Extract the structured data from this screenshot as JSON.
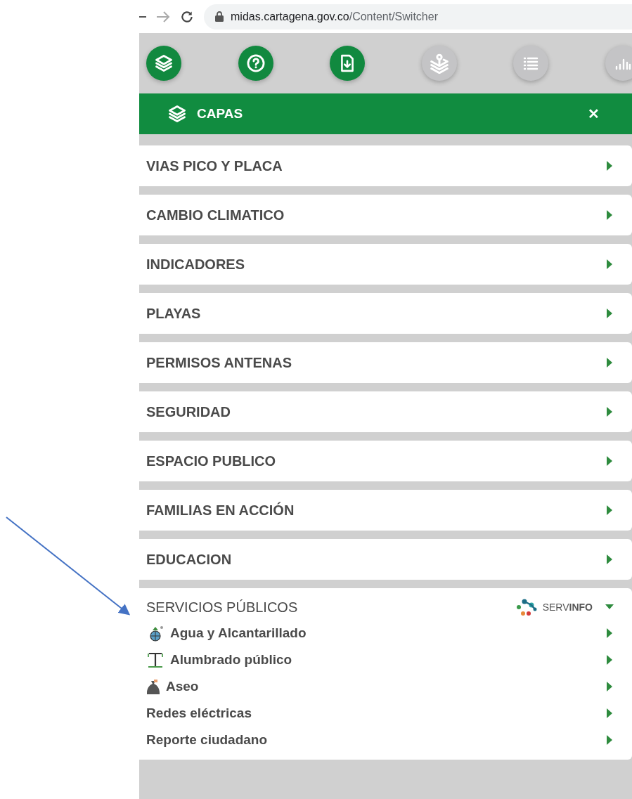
{
  "browser": {
    "url_host": "midas.cartagena.gov.co",
    "url_path": "/Content/Switcher"
  },
  "toolbar": [
    {
      "kind": "layers",
      "disabled": false
    },
    {
      "kind": "help",
      "disabled": false
    },
    {
      "kind": "download",
      "disabled": false
    },
    {
      "kind": "pin-layers",
      "disabled": true
    },
    {
      "kind": "list",
      "disabled": true
    },
    {
      "kind": "chart",
      "disabled": true
    }
  ],
  "panel": {
    "title": "CAPAS",
    "close": "✕"
  },
  "groups": [
    {
      "label": "VIAS PICO Y PLACA",
      "expanded": false
    },
    {
      "label": "CAMBIO CLIMATICO",
      "expanded": false
    },
    {
      "label": "INDICADORES",
      "expanded": false
    },
    {
      "label": "PLAYAS",
      "expanded": false
    },
    {
      "label": "PERMISOS ANTENAS",
      "expanded": false
    },
    {
      "label": "SEGURIDAD",
      "expanded": false
    },
    {
      "label": "ESPACIO PUBLICO",
      "expanded": false
    },
    {
      "label": "FAMILIAS EN ACCIÓN",
      "expanded": false
    },
    {
      "label": "EDUCACION",
      "expanded": false
    },
    {
      "label": "SERVICIOS PÚBLICOS",
      "expanded": true,
      "brand": "SERV**INFO**",
      "children": [
        {
          "label": "Agua y Alcantarillado",
          "kind": "water"
        },
        {
          "label": "Alumbrado público",
          "kind": "lamp"
        },
        {
          "label": "Aseo",
          "kind": "bag"
        },
        {
          "label": "Redes eléctricas",
          "kind": "plain"
        },
        {
          "label": "Reporte ciudadano",
          "kind": "plain"
        }
      ]
    }
  ]
}
